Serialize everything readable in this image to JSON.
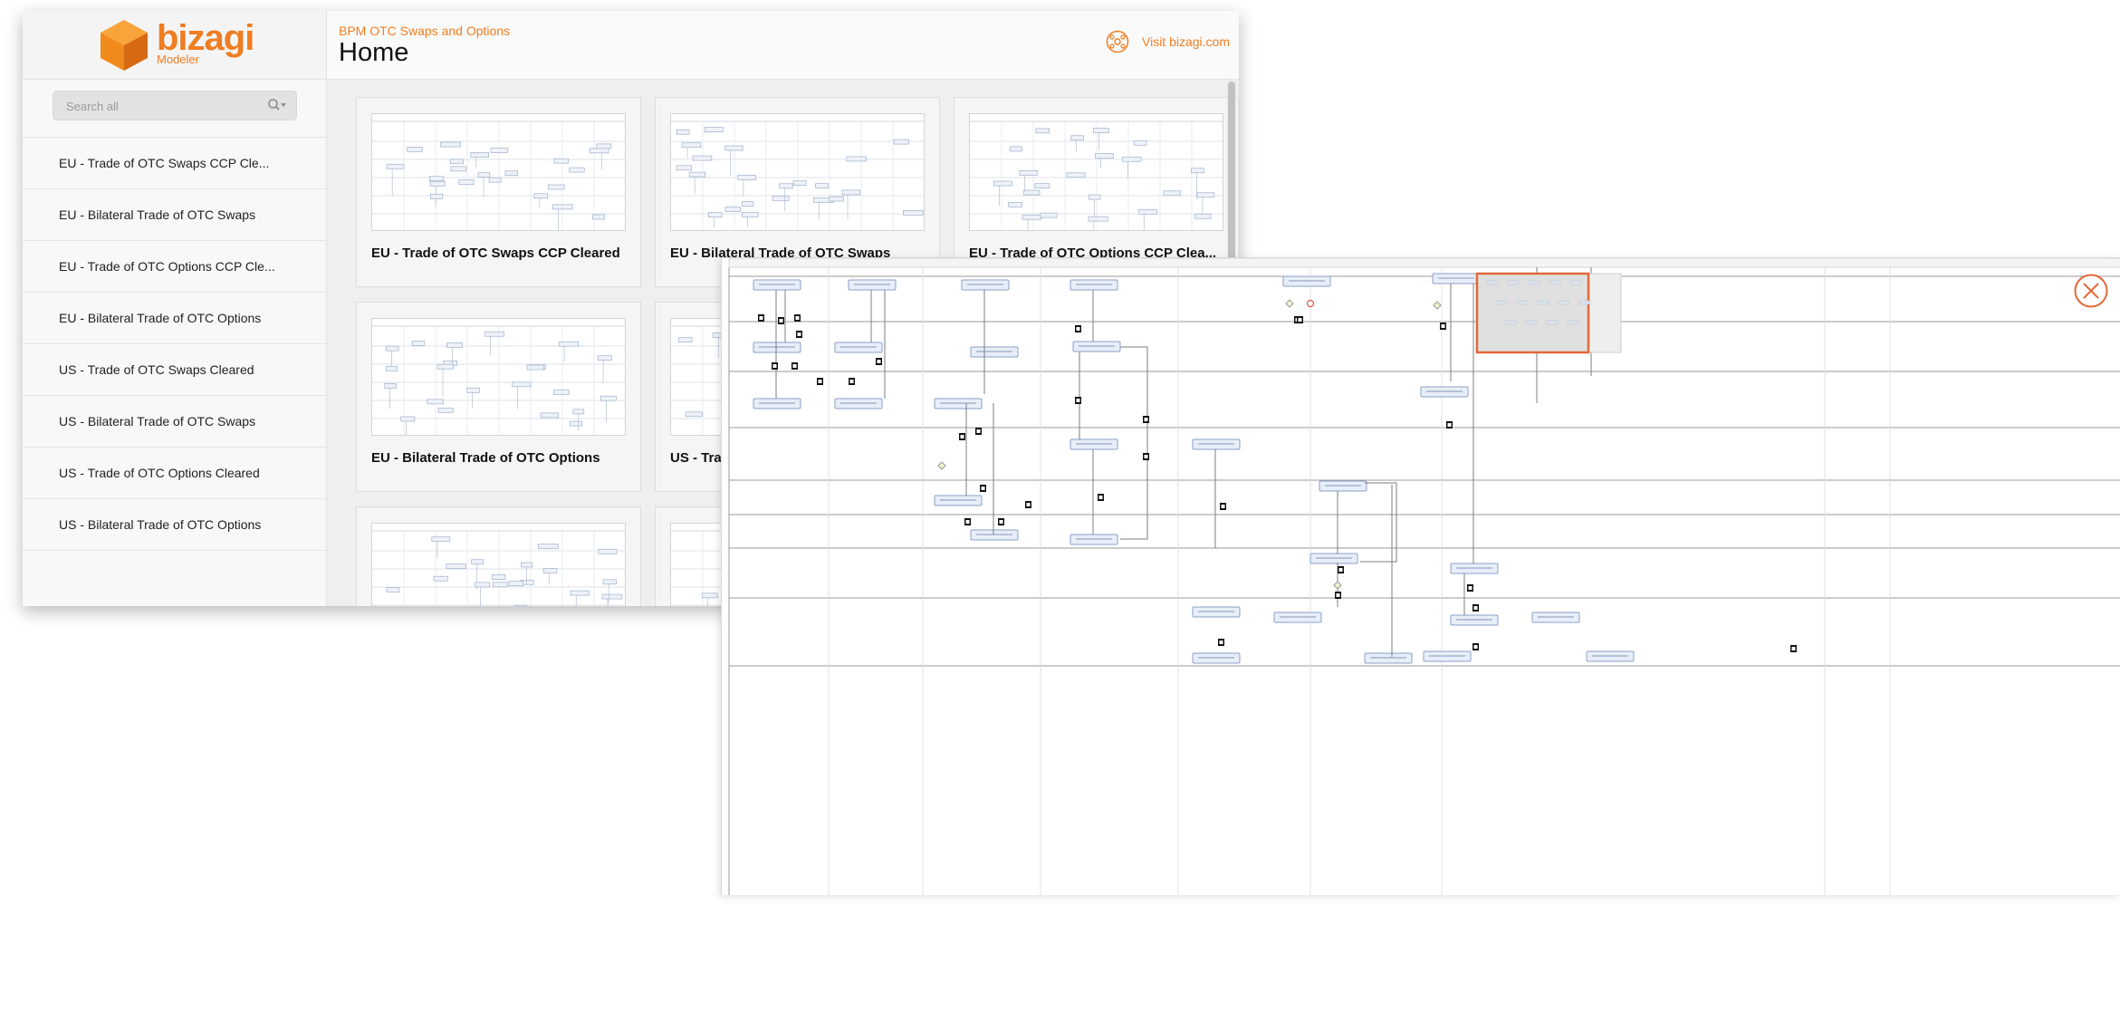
{
  "brand": {
    "name": "bizagi",
    "product": "Modeler"
  },
  "search": {
    "placeholder": "Search all"
  },
  "sidebar": {
    "items": [
      {
        "label": "EU - Trade of OTC Swaps CCP Cle..."
      },
      {
        "label": "EU - Bilateral Trade of OTC Swaps"
      },
      {
        "label": "EU - Trade of OTC Options CCP Cle..."
      },
      {
        "label": "EU - Bilateral Trade of OTC Options"
      },
      {
        "label": "US - Trade of OTC Swaps Cleared"
      },
      {
        "label": "US - Bilateral Trade of OTC Swaps"
      },
      {
        "label": "US - Trade of OTC Options Cleared"
      },
      {
        "label": "US - Bilateral Trade of OTC Options"
      }
    ]
  },
  "header": {
    "breadcrumb": "BPM OTC Swaps and Options",
    "title": "Home",
    "visit_label": "Visit bizagi.com"
  },
  "cards": [
    {
      "title": "EU - Trade of OTC Swaps CCP Cleared"
    },
    {
      "title": "EU - Bilateral Trade of OTC Swaps"
    },
    {
      "title": "EU - Trade of OTC Options CCP Clea..."
    },
    {
      "title": "EU - Bilateral Trade of OTC Options"
    },
    {
      "title": "US - Trade of OTC Swaps Cleared"
    },
    {
      "title": ""
    },
    {
      "title": ""
    },
    {
      "title": ""
    }
  ],
  "colors": {
    "accent": "#ef7d22",
    "task_fill": "#e8eef8",
    "task_stroke": "#8aa0c8",
    "lane_line": "#9a9a9a",
    "minimap_frame": "#e2693a"
  },
  "icons": {
    "close": "close-circle-icon",
    "visit": "network-icon",
    "search": "search-icon"
  }
}
